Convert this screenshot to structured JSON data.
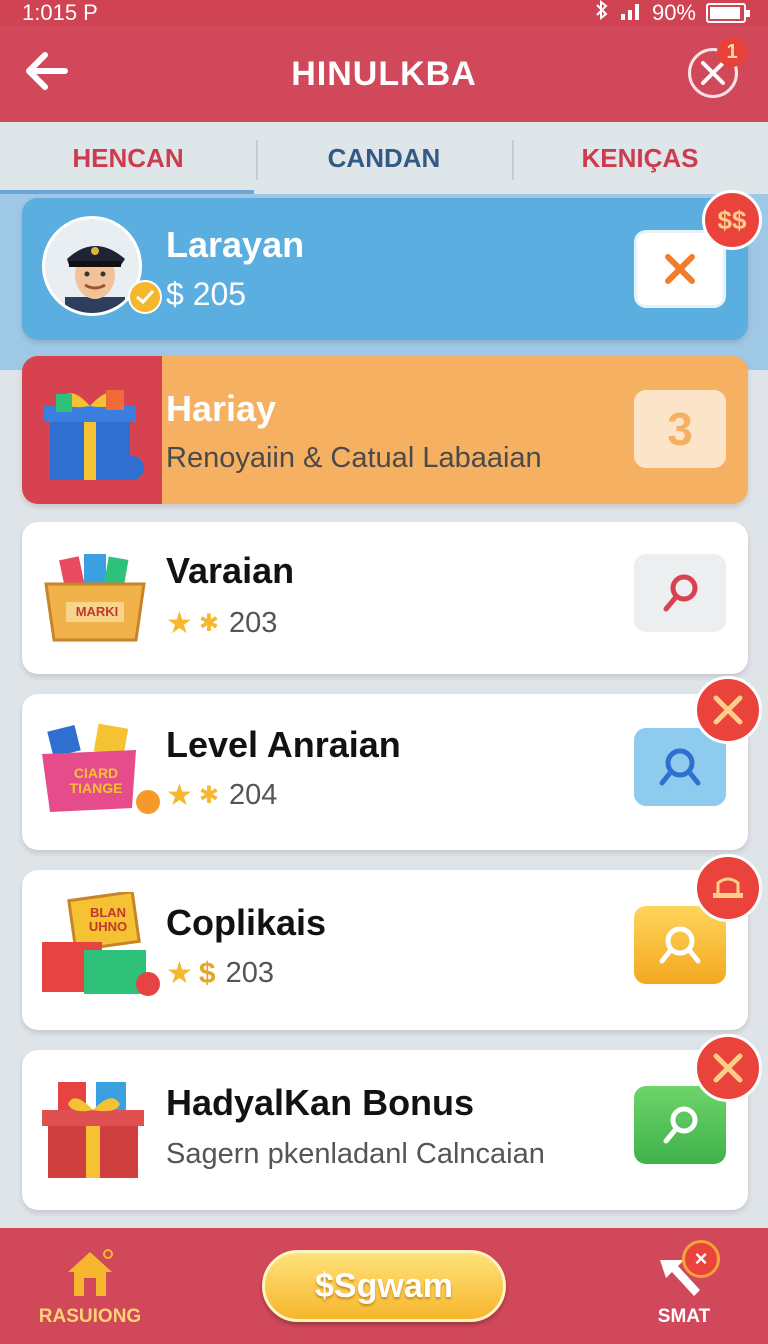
{
  "status": {
    "time": "1:015 P",
    "battery": "90%"
  },
  "header": {
    "title": "HINULKBA",
    "notification_count": "1"
  },
  "tabs": [
    {
      "label": "HENCAN"
    },
    {
      "label": "CANDAN"
    },
    {
      "label": "KENIÇAS"
    }
  ],
  "cards": [
    {
      "title": "Larayan",
      "subtitle": "$ 205",
      "action_icon": "x-icon",
      "badge": "$$"
    },
    {
      "title": "Hariay",
      "subtitle": "Renoyaiin & Catual Labaaian",
      "action_value": "3"
    },
    {
      "title": "Varaian",
      "value": "203",
      "action_icon": "magnifier-icon"
    },
    {
      "title": "Level Anraian",
      "value": "204",
      "action_icon": "search-icon",
      "badge_icon": "crossed-swords-icon"
    },
    {
      "title": "Coplikais",
      "value": "203",
      "action_icon": "search-icon",
      "badge_icon": "hat-icon"
    },
    {
      "title": "HadyalKan Bonus",
      "subtitle": "Sagern pkenladanl Calncaian",
      "action_icon": "search-icon",
      "badge_icon": "crossed-swords-icon"
    }
  ],
  "icon_labels": {
    "crate": "MARKI",
    "box_card3": "CIARD TIANGE",
    "box_card4": "BLAN UHNO"
  },
  "footer": {
    "home_label": "RASUIONG",
    "cta_label": "$Sgwam",
    "right_label": "SMAT",
    "right_badge": "×"
  },
  "colors": {
    "primary": "#d1485a",
    "card_blue": "#5aaee0",
    "card_orange": "#f5b062",
    "accent_yellow": "#f6b62d",
    "badge_red": "#e9433c"
  }
}
